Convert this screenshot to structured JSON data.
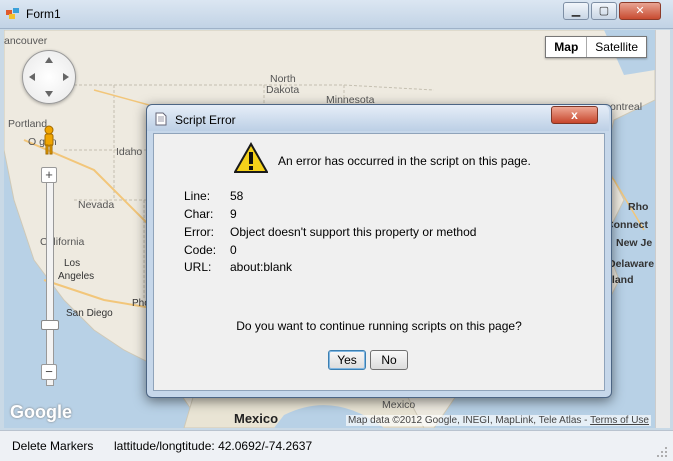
{
  "form": {
    "title": "Form1",
    "minimize_icon": "minimize-icon",
    "maximize_icon": "maximize-icon",
    "close_icon": "close-icon"
  },
  "map": {
    "type_buttons": [
      "Map",
      "Satellite"
    ],
    "active_type": "Map",
    "labels": {
      "vancouver": "ancouver",
      "portland": "Portland",
      "oregon": "O  gon",
      "idaho": "Idaho",
      "nevada": "Nevada",
      "california": "California",
      "los_angeles": "Los\nAngeles",
      "san_diego": "San Diego",
      "phoenix": "Pho",
      "north_dakota": "North\nDakota",
      "minnesota": "Minnesota",
      "montreal": "ontreal",
      "rho": "Rho",
      "connect": "Connect",
      "new_je": "New Je",
      "delaware": "Delaware",
      "ryland": "ryland",
      "mexico": "Mexico",
      "mexico_small": "Mexico"
    },
    "google_logo": "Google",
    "attribution": "Map data ©2012 Google, INEGI, MapLink, Tele Atlas - ",
    "terms_link": "Terms of Use",
    "zoom_in": "+",
    "zoom_out": "−",
    "zoom_minus2": "−"
  },
  "dialog": {
    "title": "Script Error",
    "close_label": "x",
    "message": "An error has occurred in the script on this page.",
    "fields": [
      {
        "key": "Line:",
        "value": "58"
      },
      {
        "key": "Char:",
        "value": "9"
      },
      {
        "key": "Error:",
        "value": "Object doesn't support this property or method"
      },
      {
        "key": "Code:",
        "value": "0"
      },
      {
        "key": "URL:",
        "value": "about:blank"
      }
    ],
    "question": "Do you want to continue running scripts on this page?",
    "yes_label": "Yes",
    "no_label": "No"
  },
  "statusbar": {
    "delete_markers": "Delete Markers",
    "coords": "lattitude/longtitude: 42.0692/-74.2637"
  }
}
